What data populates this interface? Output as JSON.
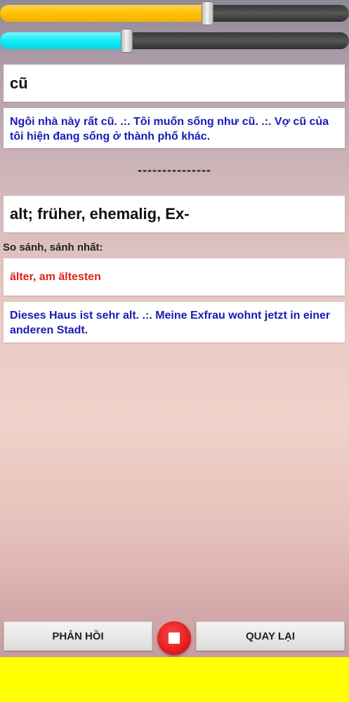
{
  "sliders": [
    {
      "name": "speed",
      "value": 0.595,
      "color": "#ffbf00"
    },
    {
      "name": "volume",
      "value": 0.365,
      "color": "#11e9f2"
    }
  ],
  "vietnamese": {
    "word": "cũ",
    "example": "Ngôi nhà này rất cũ. .:. Tôi muốn sống như cũ. .:. Vợ cũ của tôi hiện đang sống ở thành phố khác."
  },
  "separator": "---------------",
  "german": {
    "word": "alt; früher, ehemalig, Ex-",
    "comparison_label": "So sánh, sánh nhất:",
    "comparison": "älter, am ältesten",
    "example": "Dieses Haus ist sehr alt. .:. Meine Exfrau wohnt jetzt in einer anderen Stadt."
  },
  "buttons": {
    "feedback": "PHẢN HỒI",
    "back": "QUAY LẠI"
  },
  "colors": {
    "example_text": "#1a1ab8",
    "comparison_text": "#e02020",
    "bottom_bar": "#ffff00",
    "stop_button": "#e01616"
  }
}
